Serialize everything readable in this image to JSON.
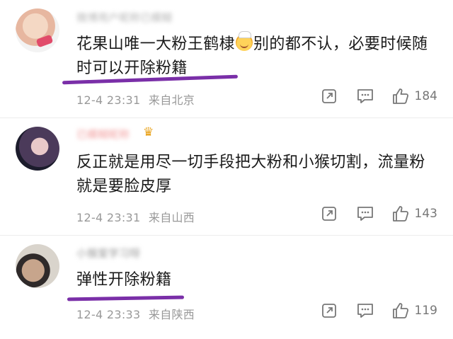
{
  "comments": [
    {
      "username": "微博用户昵称已模糊",
      "text_before_emoji": "花果山唯一大粉王鹤棣",
      "emoji": "smiling-face-with-chef-hat",
      "text_after_emoji": "别的都不认，必要时候随时可以开除粉籍",
      "timestamp": "12-4 23:31",
      "location": "来自北京",
      "likes": "184"
    },
    {
      "username": "已模糊昵称",
      "text": "反正就是用尽一切手段把大粉和小猴切割，流量粉就是要脸皮厚",
      "timestamp": "12-4 23:31",
      "location": "来自山西",
      "likes": "143"
    },
    {
      "username": "小猴爱学习呀",
      "text": "弹性开除粉籍",
      "timestamp": "12-4 23:33",
      "location": "来自陕西",
      "likes": "119"
    }
  ],
  "icons": {
    "share": "share-icon",
    "comment": "comment-icon",
    "like": "like-icon",
    "crown": "crown-icon"
  },
  "colors": {
    "highlight_underline": "#7a2fa8",
    "meta_text": "#999999",
    "body_text": "#1a1a1a"
  }
}
